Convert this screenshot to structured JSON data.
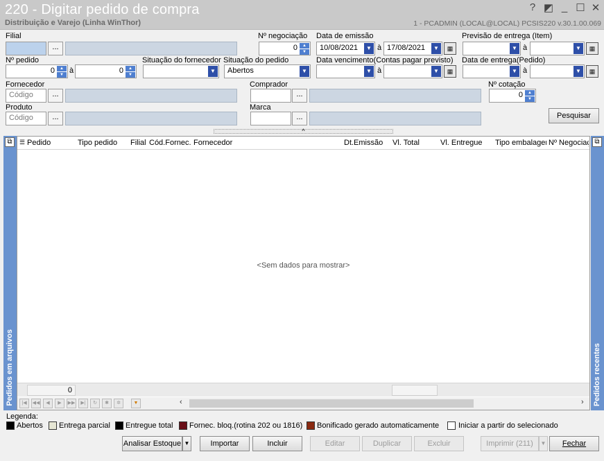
{
  "window": {
    "title": "220 - Digitar pedido de compra",
    "subtitle": "Distribuição e Varejo (Linha WinThor)",
    "userinfo": "1 - PCADMIN (LOCAL@LOCAL)   PCSIS220  v.30.1.00.069",
    "help": "?",
    "restore": "◩",
    "minimize": "_",
    "maximize": "☐",
    "close": "✕"
  },
  "filters": {
    "filial_label": "Filial",
    "num_negociacao_label": "Nº negociação",
    "num_negociacao_value": "0",
    "data_emissao_label": "Data de emissão",
    "data_emissao_from": "10/08/2021",
    "data_emissao_to": "17/08/2021",
    "previsao_entrega_label": "Previsão  de entrega (Item)",
    "num_pedido_label": "Nº pedido",
    "num_pedido_from": "0",
    "num_pedido_to": "0",
    "situacao_fornecedor_label": "Situação do fornecedor",
    "situacao_pedido_label": "Situação do pedido",
    "situacao_pedido_value": "Abertos",
    "data_vencimento_label": "Data vencimento(Contas pagar previsto)",
    "data_entrega_label": "Data de entrega(Pedido)",
    "fornecedor_label": "Fornecedor",
    "codigo_placeholder": "Código",
    "comprador_label": "Comprador",
    "num_cotacao_label": "Nº cotação",
    "num_cotacao_value": "0",
    "produto_label": "Produto",
    "marca_label": "Marca",
    "a_label": "à",
    "dots_label": "...",
    "pesquisar_label": "Pesquisar",
    "collapse_glyph": "^"
  },
  "grid": {
    "columns": [
      "Pedido",
      "Tipo pedido",
      "Filial",
      "Cód.Fornec.",
      "Fornecedor",
      "Dt.Emissão",
      "Vl. Total",
      "Vl. Entregue",
      "Tipo embalagem",
      "Nº Negociaç"
    ],
    "empty_text": "<Sem dados para mostrar>",
    "row_count": "0",
    "left_panel": "Pedidos em arquivos",
    "right_panel": "Pedidos recentes"
  },
  "legend": {
    "title": "Legenda:",
    "items": [
      {
        "label": "Abertos",
        "color": "#000000"
      },
      {
        "label": "Entrega parcial",
        "color": "#e6e6d4"
      },
      {
        "label": "Entregue total",
        "color": "#000000"
      },
      {
        "label": "Fornec. bloq.(rotina 202 ou 1816)",
        "color": "#6a0f18"
      },
      {
        "label": "Bonificado gerado automaticamente",
        "color": "#8a2a12"
      }
    ],
    "iniciar_label": "Iniciar a partir do selecionado"
  },
  "actions": {
    "analisar": "Analisar Estoque",
    "importar": "Importar",
    "incluir": "Incluir",
    "editar": "Editar",
    "duplicar": "Duplicar",
    "excluir": "Excluir",
    "imprimir": "Imprimir (211)",
    "fechar": "Fechar"
  }
}
